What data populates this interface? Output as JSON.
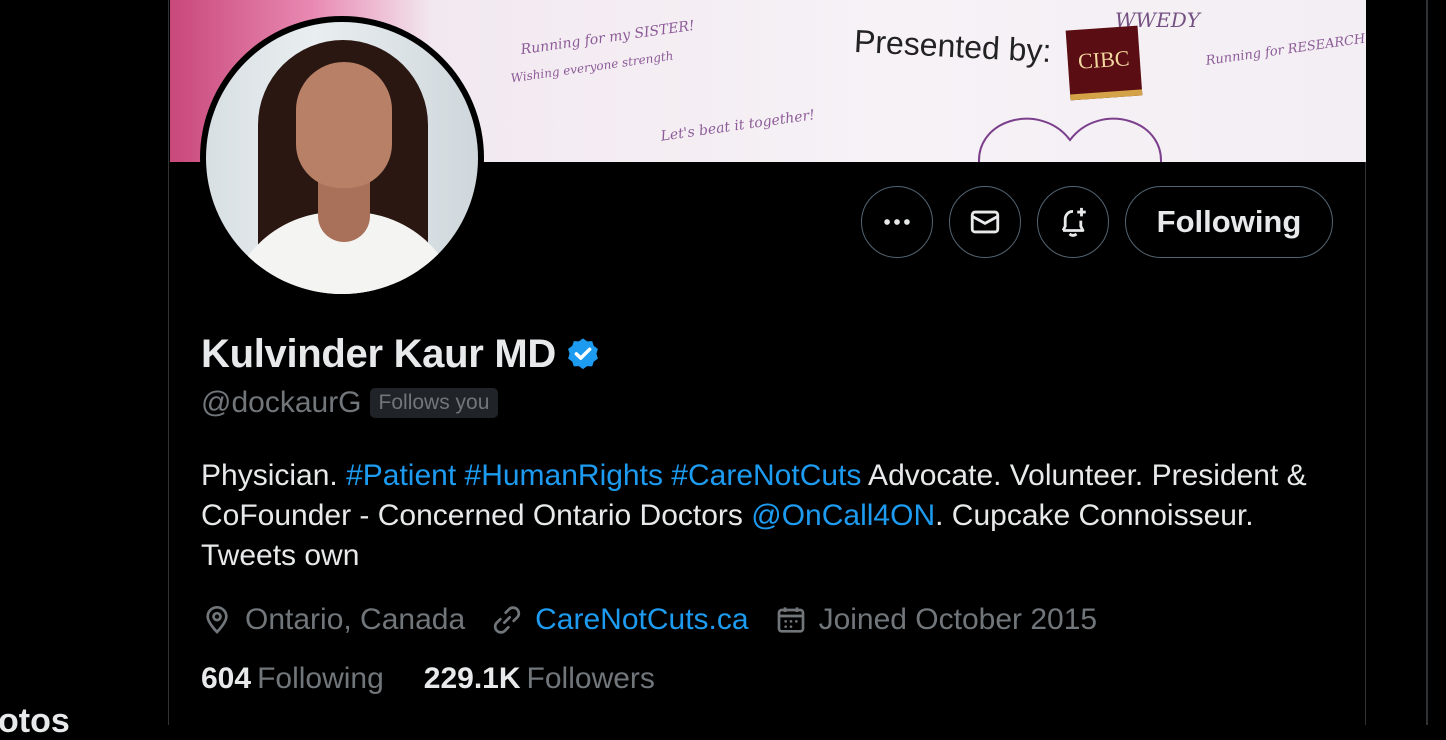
{
  "banner": {
    "presented_text": "Presented by:",
    "sponsor_logo": "CIBC",
    "scrawls": [
      "Running for my SISTER!",
      "Wishing everyone strength",
      "Let's beat it together!",
      "WWEDY",
      "Running for RESEARCH!!"
    ]
  },
  "profile": {
    "name": "Kulvinder Kaur MD",
    "handle": "@dockaurG",
    "follows_you": "Follows you",
    "bio": {
      "p1": "Physician. ",
      "tag1": "#Patient",
      "sp1": " ",
      "tag2": "#HumanRights",
      "sp2": " ",
      "tag3": "#CareNotCuts",
      "p2": " Advocate. Volunteer. President & CoFounder - Concerned Ontario Doctors ",
      "mention": "@OnCall4ON",
      "p3": ". Cupcake Connoisseur. Tweets own"
    },
    "location": "Ontario, Canada",
    "website": "CareNotCuts.ca",
    "joined": "Joined October 2015",
    "following_count": "604",
    "following_label": "Following",
    "followers_count": "229.1K",
    "followers_label": "Followers"
  },
  "actions": {
    "more_icon": "more-icon",
    "message_icon": "mail-icon",
    "notify_icon": "bell-plus-icon",
    "follow_label": "Following"
  },
  "left_peek_text": "otos",
  "colors": {
    "background": "#000000",
    "text": "#e7e9ea",
    "secondary": "#71767b",
    "accent": "#1d9bf0",
    "border": "#536471"
  }
}
